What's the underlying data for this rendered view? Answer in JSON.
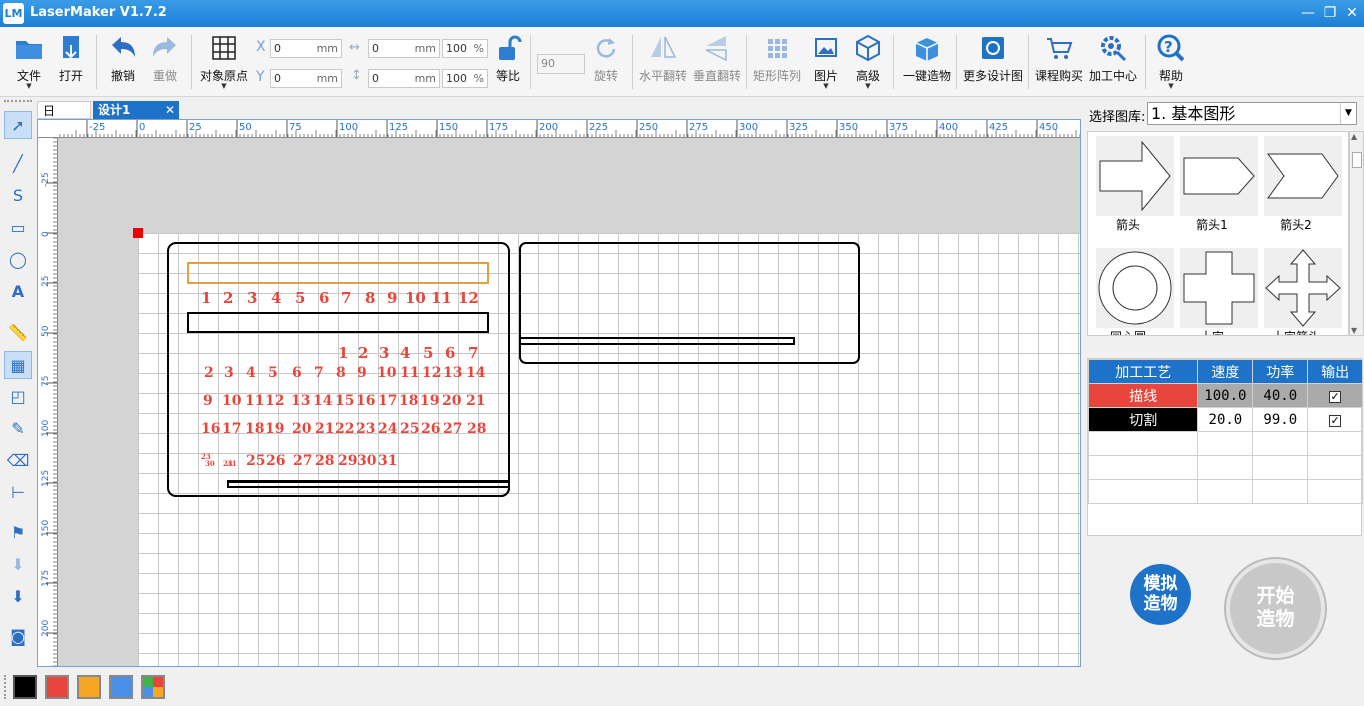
{
  "app": {
    "title": "LaserMaker V1.7.2",
    "logo_text": "LM"
  },
  "toolbar": {
    "file": "文件",
    "open": "打开",
    "undo": "撤销",
    "redo": "重做",
    "origin": "对象原点",
    "lock": "等比",
    "rotate": "旋转",
    "hflip": "水平翻转",
    "vflip": "垂直翻转",
    "array": "矩形阵列",
    "picture": "图片",
    "advanced": "高级",
    "oneclick": "一键造物",
    "more_designs": "更多设计图",
    "course": "课程购买",
    "center": "加工中心",
    "help": "帮助",
    "x_label": "X",
    "y_label": "Y",
    "x_value": "0",
    "y_value": "0",
    "w_value": "0",
    "h_value": "0",
    "unit": "mm",
    "w_pct": "100",
    "h_pct": "100",
    "pct": "%",
    "rotate_value": "90"
  },
  "tabs": [
    {
      "label": "日历.lcp"
    },
    {
      "label": "设计1"
    }
  ],
  "tab_close": "✕",
  "ruler": {
    "h_ticks": [
      "-25",
      "0",
      "25",
      "50",
      "75",
      "100",
      "125",
      "150",
      "175",
      "200",
      "225",
      "250",
      "275",
      "300",
      "325",
      "350",
      "375",
      "400",
      "425",
      "450"
    ],
    "v_ticks": [
      "-25",
      "0",
      "25",
      "50",
      "75",
      "100",
      "125",
      "150",
      "175",
      "200"
    ]
  },
  "calendar": {
    "months": [
      "1",
      "2",
      "3",
      "4",
      "5",
      "6",
      "7",
      "8",
      "9",
      "10",
      "11",
      "12"
    ],
    "week1": [
      "1",
      "2",
      "3",
      "4",
      "5",
      "6",
      "7"
    ],
    "week2": [
      "2",
      "3",
      "4",
      "5",
      "6",
      "7",
      "8",
      "9",
      "10",
      "11",
      "12",
      "13",
      "14"
    ],
    "week3": [
      "9",
      "10",
      "11",
      "12",
      "13",
      "14",
      "15",
      "16",
      "17",
      "18",
      "19",
      "20",
      "21"
    ],
    "week4": [
      "16",
      "17",
      "18",
      "19",
      "20",
      "21",
      "22",
      "23",
      "24",
      "25",
      "26",
      "27",
      "28"
    ],
    "week5_small": [
      "23",
      "30",
      "24",
      "31"
    ],
    "week5": [
      "25",
      "26",
      "27",
      "28",
      "29",
      "30",
      "31"
    ]
  },
  "library": {
    "label": "选择图库:",
    "selected": "1. 基本图形",
    "shapes": [
      "箭头",
      "箭头1",
      "箭头2",
      "同心圆",
      "十字",
      "十字箭头"
    ]
  },
  "process": {
    "headers": [
      "加工工艺",
      "速度",
      "功率",
      "输出"
    ],
    "rows": [
      {
        "name": "描线",
        "speed": "100.0",
        "power": "40.0",
        "output": "✓",
        "color": "#e8463c"
      },
      {
        "name": "切割",
        "speed": "20.0",
        "power": "99.0",
        "output": "✓",
        "color": "#000000"
      }
    ]
  },
  "buttons": {
    "simulate": "模拟\n造物",
    "simulate_l1": "模拟",
    "simulate_l2": "造物",
    "start_l1": "开始",
    "start_l2": "造物"
  },
  "colors": {
    "accent": "#1e73c8",
    "calendar_red": "#e8463c",
    "selection_orange": "#e0a040"
  },
  "palette": [
    "#000000",
    "#e8463c",
    "#f5a623",
    "#4a8fe8",
    "multi"
  ]
}
